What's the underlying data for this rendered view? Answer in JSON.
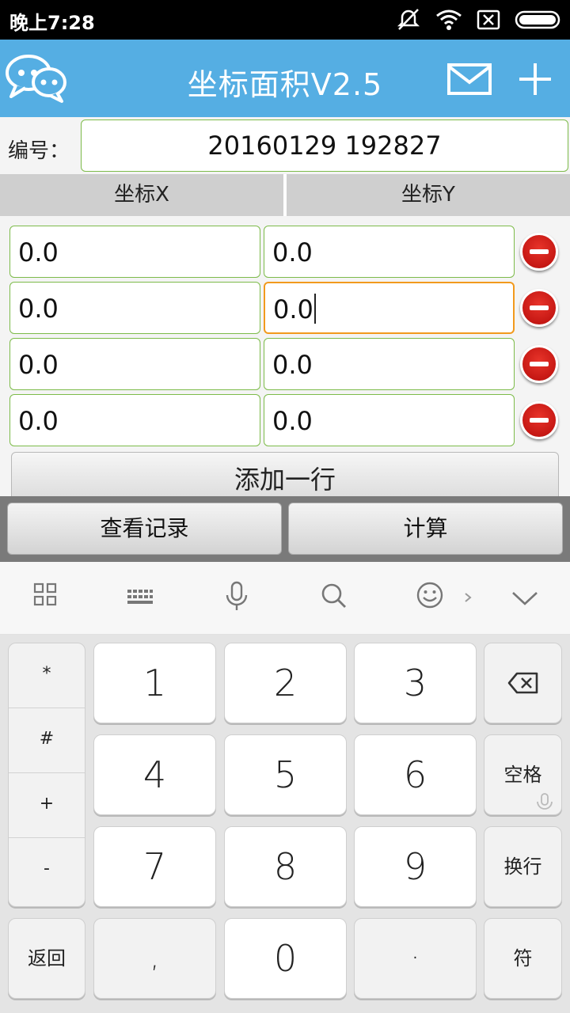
{
  "status": {
    "time": "晚上7:28"
  },
  "app": {
    "title": "坐标面积V2.5"
  },
  "id_row": {
    "label": "编号：",
    "value": "20160129 192827"
  },
  "columns": {
    "x": "坐标X",
    "y": "坐标Y"
  },
  "rows": [
    {
      "x": "0.0",
      "y": "0.0"
    },
    {
      "x": "0.0",
      "y": "0.0"
    },
    {
      "x": "0.0",
      "y": "0.0"
    },
    {
      "x": "0.0",
      "y": "0.0"
    }
  ],
  "add_row_label": "添加一行",
  "actions": {
    "records": "查看记录",
    "calculate": "计算"
  },
  "keyboard": {
    "symbols": [
      "*",
      "#",
      "+",
      "-"
    ],
    "digits": [
      "1",
      "2",
      "3",
      "4",
      "5",
      "6",
      "7",
      "8",
      "9",
      "0"
    ],
    "space": "空格",
    "newline": "换行",
    "back": "返回",
    "comma": ",",
    "dot": "·",
    "symbol": "符"
  },
  "colors": {
    "accent": "#55aee3",
    "field_border": "#7dbb4a",
    "focus_border": "#f29a1d",
    "delete": "#d21f1a"
  }
}
